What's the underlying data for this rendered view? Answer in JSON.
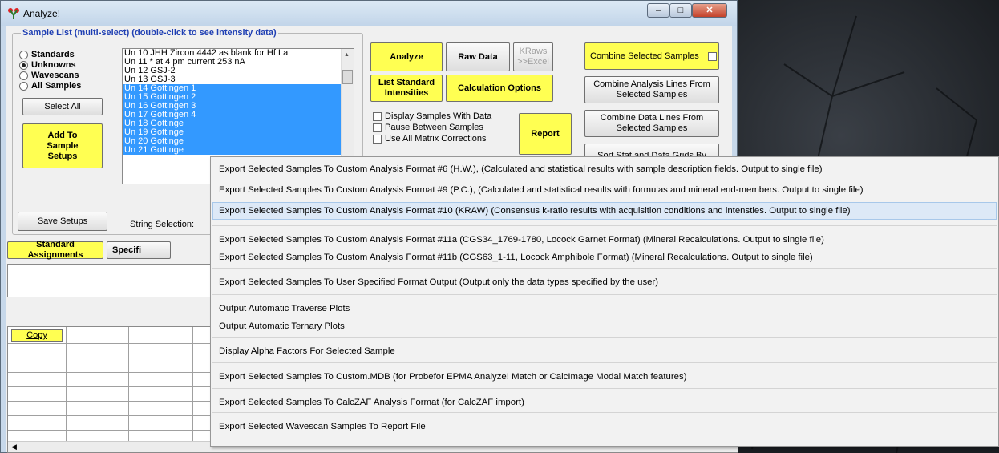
{
  "window": {
    "title": "Analyze!",
    "min": "–",
    "max": "□",
    "close": "✕"
  },
  "sample_group": {
    "title": "Sample List (multi-select) (double-click to see intensity data)",
    "radios": [
      "Standards",
      "Unknowns",
      "Wavescans",
      "All Samples"
    ],
    "selected": "Unknowns"
  },
  "samples": [
    {
      "text": "Un  10 JHH Zircon 4442 as blank for Hf La",
      "selected": false
    },
    {
      "text": "Un  11 * at  4 pm current 253 nA",
      "selected": false
    },
    {
      "text": "Un  12 GSJ-2",
      "selected": false
    },
    {
      "text": "Un  13 GSJ-3",
      "selected": false
    },
    {
      "text": "Un  14 Gottingen 1",
      "selected": true
    },
    {
      "text": "Un  15 Gottingen 2",
      "selected": true
    },
    {
      "text": "Un  16 Gottingen 3",
      "selected": true
    },
    {
      "text": "Un  17 Gottingen 4",
      "selected": true
    },
    {
      "text": "Un  18 Gottinge",
      "selected": true
    },
    {
      "text": "Un  19 Gottinge",
      "selected": true
    },
    {
      "text": "Un  20 Gottinge",
      "selected": true
    },
    {
      "text": "Un  21 Gottinge",
      "selected": true
    }
  ],
  "buttons": {
    "select_all": "Select All",
    "add_to_setups": "Add To Sample Setups",
    "save_setups": "Save Setups",
    "analyze": "Analyze",
    "raw_data": "Raw Data",
    "kraws": "KRaws >>Excel",
    "list_std": "List Standard Intensities",
    "calc_options": "Calculation Options",
    "report": "Report",
    "combine_selected": "Combine Selected Samples",
    "combine_lines": "Combine Analysis Lines From Selected Samples",
    "combine_data_lines": "Combine Data Lines From Selected Samples",
    "sort_stat": "Sort Stat and Data Grids By",
    "std_assign": "Standard Assignments",
    "specified": "Specifi",
    "copy": "Copy"
  },
  "options": [
    "Display Samples With Data",
    "Pause Between Samples",
    "Use All Matrix Corrections"
  ],
  "string_selection": "String Selection:",
  "menu": [
    "Export Selected Samples To Custom Analysis Format #6 (H.W.), (Calculated and statistical results with sample description fields. Output to single file)",
    "Export Selected Samples To Custom Analysis Format #9 (P.C.), (Calculated and statistical results with formulas and mineral end-members. Output to single file)",
    "Export Selected Samples To Custom Analysis Format #10 (KRAW) (Consensus k-ratio results with acquisition conditions and intensties. Output to single file)",
    "Export Selected Samples To Custom Analysis Format #11a (CGS34_1769-1780, Locock Garnet Format) (Mineral Recalculations. Output to single file)",
    "Export Selected Samples To Custom Analysis Format #11b (CGS63_1-11, Locock Amphibole Format) (Mineral Recalculations. Output to single file)",
    "Export Selected Samples To User Specified Format Output (Output only the data types specified by the user)",
    "Output Automatic Traverse Plots",
    "Output Automatic Ternary Plots",
    "Display Alpha Factors For Selected Sample",
    "Export Selected Samples To Custom.MDB (for Probefor EPMA Analyze! Match or CalcImage Modal Match features)",
    "Export Selected Samples To CalcZAF Analysis Format (for CalcZAF import)",
    "Export Selected Wavescan Samples To Report File"
  ],
  "menu_hover_index": 2,
  "colors": {
    "highlight": "#3399ff",
    "yellow": "#ffff52",
    "group_title": "#1f3fb3"
  }
}
